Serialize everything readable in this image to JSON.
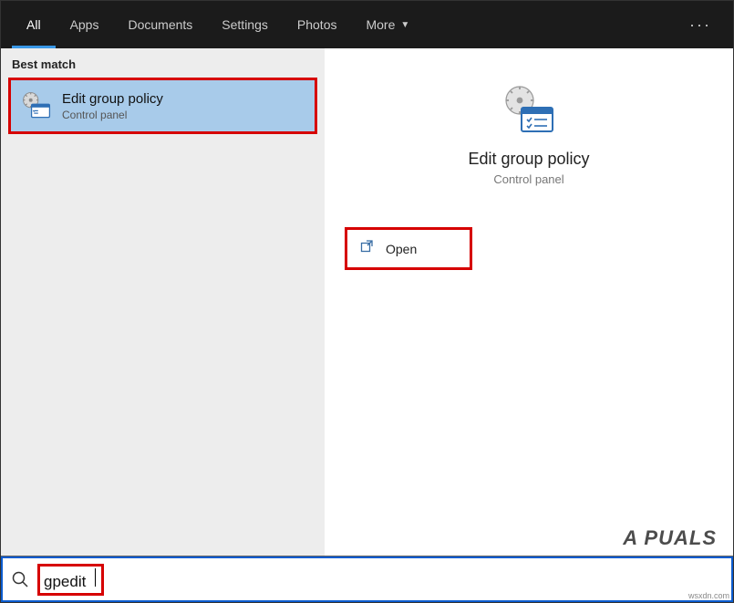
{
  "topbar": {
    "tabs": {
      "all": "All",
      "apps": "Apps",
      "documents": "Documents",
      "settings": "Settings",
      "photos": "Photos",
      "more": "More"
    }
  },
  "left": {
    "section": "Best match",
    "result": {
      "title": "Edit group policy",
      "subtitle": "Control panel"
    }
  },
  "right": {
    "title": "Edit group policy",
    "subtitle": "Control panel",
    "open_label": "Open"
  },
  "search": {
    "value": "gpedit"
  },
  "watermark": "A PUALS",
  "attribution": "wsxdn.com"
}
